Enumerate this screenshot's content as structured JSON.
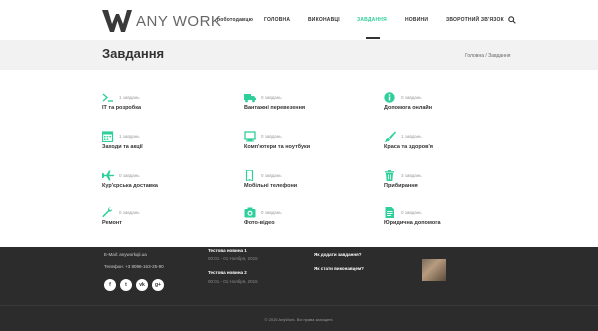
{
  "header": {
    "logo_text": "ANY WORK",
    "nav": [
      {
        "label": "роботодавцю",
        "active": false
      },
      {
        "label": "ГОЛОВНА",
        "active": false
      },
      {
        "label": "ВИКОНАВЦІ",
        "active": false
      },
      {
        "label": "ЗАВДАННЯ",
        "active": true
      },
      {
        "label": "НОВИНИ",
        "active": false
      },
      {
        "label": "ЗВОРОТНИЙ ЗВ'ЯЗОК",
        "active": false
      }
    ],
    "search_icon": "search-icon",
    "accent_color": "#2fcf9b"
  },
  "titlebar": {
    "title": "Завдання",
    "breadcrumb": "Головна / Завдання"
  },
  "categories": [
    {
      "icon": "terminal-icon",
      "count": "1 завдань",
      "name": "IT та розробка"
    },
    {
      "icon": "truck-icon",
      "count": "0 завдань",
      "name": "Вантажні перевезення"
    },
    {
      "icon": "info-icon",
      "count": "0 завдань",
      "name": "Допомога онлайн"
    },
    {
      "icon": "calendar-icon",
      "count": "1 завдань",
      "name": "Заходи та акції"
    },
    {
      "icon": "laptop-icon",
      "count": "0 завдань",
      "name": "Комп'ютери та ноутбуки"
    },
    {
      "icon": "brush-icon",
      "count": "1 завдань",
      "name": "Краса та здоров'я"
    },
    {
      "icon": "plane-icon",
      "count": "0 завдань",
      "name": "Кур'єрська доставка"
    },
    {
      "icon": "phone-icon",
      "count": "0 завдань",
      "name": "Мобільні телефони"
    },
    {
      "icon": "trash-icon",
      "count": "3 завдань",
      "name": "Прибирання"
    },
    {
      "icon": "wrench-icon",
      "count": "0 завдань",
      "name": "Ремонт"
    },
    {
      "icon": "camera-icon",
      "count": "0 завдань",
      "name": "Фото-відео"
    },
    {
      "icon": "document-icon",
      "count": "0 завдань",
      "name": "Юридична допомога"
    }
  ],
  "footer": {
    "email": "E-Mail: anyworkqii.ua",
    "phone": "Телефон: +3 8096-163-25-90",
    "news_title_1": "Тестова новина 1",
    "news_date_1": "00:01 - 01 Ноября, 2015",
    "news_title_2": "Тестова новина 2",
    "news_date_2": "00:01 - 01 Ноября, 2015",
    "link_1": "Як додати завдання?",
    "link_2": "Як стати виконавцем?",
    "socials": [
      {
        "icon": "facebook-icon",
        "glyph": "f"
      },
      {
        "icon": "twitter-icon",
        "glyph": "t"
      },
      {
        "icon": "vk-icon",
        "glyph": "vk"
      },
      {
        "icon": "googleplus-icon",
        "glyph": "g+"
      }
    ],
    "copyright": "© 2015 AnyWork. Всі права захищені."
  }
}
